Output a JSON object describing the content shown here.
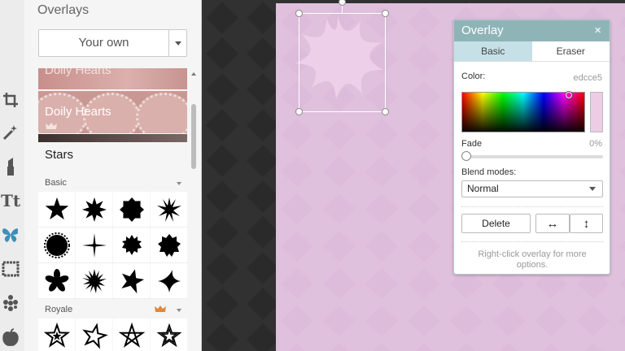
{
  "panel": {
    "title": "Overlays",
    "source_select": "Your own",
    "thumbnails": [
      {
        "label": "Doily Hearts"
      },
      {
        "label": "Doily Hearts"
      }
    ],
    "section_title": "Stars",
    "groups": [
      {
        "label": "Basic"
      },
      {
        "label": "Royale"
      }
    ]
  },
  "dialog": {
    "title": "Overlay",
    "close_glyph": "×",
    "tabs": [
      "Basic",
      "Eraser"
    ],
    "active_tab": "Basic",
    "color_label": "Color:",
    "color_value": "edcce5",
    "color_hex": "#edcce5",
    "fade_label": "Fade",
    "fade_value": "0%",
    "fade_fraction": 0,
    "blend_label": "Blend modes:",
    "blend_value": "Normal",
    "delete_label": "Delete",
    "flip_h_glyph": "↔",
    "flip_v_glyph": "↕",
    "hint": "Right-click overlay for more options."
  },
  "colors": {
    "photo_bg": "#e0c1de",
    "dialog_header": "#8fb4b7",
    "active_tab": "#c5e0e6",
    "accent_butterfly": "#3d8fb8",
    "crown": "#e0883a"
  },
  "icons": [
    "crop-icon",
    "magic-wand-icon",
    "lipstick-icon",
    "text-icon",
    "butterfly-icon",
    "frame-icon",
    "texture-icon",
    "apple-icon"
  ]
}
